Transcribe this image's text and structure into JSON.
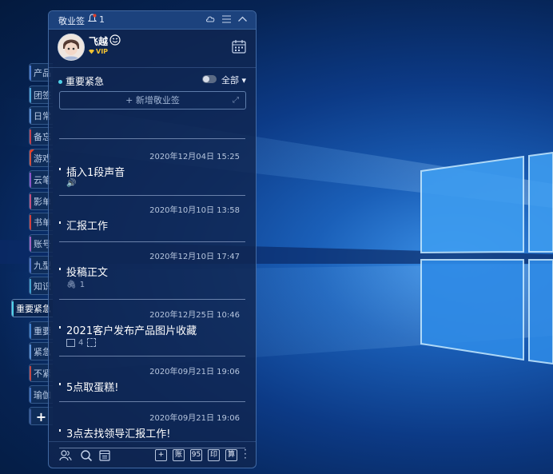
{
  "side_tabs": [
    {
      "label": "产品",
      "color": "#4a7bd0"
    },
    {
      "label": "团签",
      "color": "#4aa3d8"
    },
    {
      "label": "日常",
      "color": "#5a8fd8"
    },
    {
      "label": "备忘",
      "color": "#c04050"
    },
    {
      "label": "游戏",
      "color": "#d05040",
      "badge": true
    },
    {
      "label": "云笔",
      "color": "#8a55c8"
    },
    {
      "label": "影单",
      "color": "#c05080"
    },
    {
      "label": "书单",
      "color": "#d04040"
    },
    {
      "label": "账号",
      "color": "#a060c0"
    },
    {
      "label": "九型",
      "color": "#4a70c8"
    },
    {
      "label": "知识",
      "color": "#40a0d0"
    },
    {
      "label": "重要紧急",
      "color": "#4fd1e8",
      "active": true
    },
    {
      "label": "重要",
      "color": "#4080d0"
    },
    {
      "label": "紧急",
      "color": "#5a90d8"
    },
    {
      "label": "不紧",
      "color": "#c04848"
    },
    {
      "label": "瑜伽",
      "color": "#4070c0"
    },
    {
      "label": "+",
      "color": "#3a5a9a",
      "add": true
    }
  ],
  "app": {
    "title": "敬业签",
    "notif_count": "1"
  },
  "user": {
    "name": "飞越",
    "vip": "VIP"
  },
  "category": {
    "name": "重要紧急",
    "filter": "全部 ▾"
  },
  "add_button": {
    "label": "+ 新增敬业签",
    "expand": "⤢"
  },
  "notes": [
    {
      "date": "2020年12月04日 15:25",
      "title": "插入1段声音",
      "meta": "🔊",
      "meta_type": "audio"
    },
    {
      "date": "2020年10月10日 13:58",
      "title": "汇报工作",
      "meta": ""
    },
    {
      "date": "2020年12月10日 17:47",
      "title": "投稿正文",
      "meta": "1",
      "meta_type": "attach"
    },
    {
      "date": "2020年12月25日 10:46",
      "title": "2021客户发布产品图片收藏",
      "meta": "4",
      "meta_type": "image"
    },
    {
      "date": "2020年09月21日 19:06",
      "title": "5点取蛋糕!",
      "meta": ""
    },
    {
      "date": "2020年09月21日 19:06",
      "title": "3点去找领导汇报工作!",
      "meta": ""
    }
  ],
  "bottom_tools": [
    "+",
    "账",
    "95",
    "印",
    "算"
  ]
}
